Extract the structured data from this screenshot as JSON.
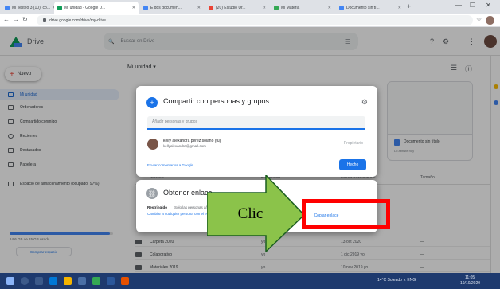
{
  "browser": {
    "tabs": [
      {
        "label": "Mi Testeo 3 (10), co...",
        "color": "#4285f4"
      },
      {
        "label": "Mi unidad - Google D...",
        "color": "#0f9d58"
      },
      {
        "label": "E dos documen...",
        "color": "#4285f4"
      },
      {
        "label": "(20) Estudio Ur...",
        "color": "#ea4335"
      },
      {
        "label": "Mi Materia",
        "color": "#34a853"
      },
      {
        "label": "Documento sin tí...",
        "color": "#4285f4"
      }
    ],
    "new_tab": "+",
    "window_controls": [
      "—",
      "❐",
      "✕"
    ],
    "url": "drive.google.com/drive/my-drive"
  },
  "drive": {
    "title": "Drive",
    "search_placeholder": "Buscar en Drive",
    "breadcrumb": "Mi unidad ▾"
  },
  "sidebar": {
    "new_label": "Nuevo",
    "items": [
      {
        "label": "Mi unidad"
      },
      {
        "label": "Ordenadores"
      },
      {
        "label": "Compartido conmigo"
      },
      {
        "label": "Recientes"
      },
      {
        "label": "Destacados"
      },
      {
        "label": "Papelera"
      },
      {
        "label": "Espacio de almacenamiento (ocupado: 97%)"
      }
    ],
    "storage_fraction": 0.97,
    "storage_text": "14,6 GB de 15 GB usado",
    "buy_label": "Comprar espacio"
  },
  "main": {
    "quick_cards": [
      {
        "label": "Documento sin título",
        "sub": "Lo abriste hoy"
      },
      {
        "label": "",
        "sub": ""
      }
    ],
    "list_header": [
      "Nombre",
      "Propietario",
      "Última modificación",
      "Tamaño"
    ],
    "files": [
      {
        "name": "Carpeta 2020",
        "owner": "yo",
        "modified": "13 oct 2020",
        "size": "—"
      },
      {
        "name": "Colaborativo",
        "owner": "yo",
        "modified": "1 dic 2019 yo",
        "size": "—"
      },
      {
        "name": "Materiales 2019",
        "owner": "yo",
        "modified": "10 nov 2019 yo",
        "size": "—"
      }
    ]
  },
  "share_dialog": {
    "title": "Compartir con personas y grupos",
    "input_placeholder": "Añadir personas y grupos",
    "person_name": "kelly alexandra pérez solano (tú)",
    "person_email": "kellyalexandra@gmail.com",
    "person_role": "Propietario",
    "feedback_link": "Enviar comentarios a Google",
    "done_label": "Hecho"
  },
  "link_dialog": {
    "title": "Obtener enlace",
    "restricted_label": "Restringido",
    "restricted_desc": "Solo las personas añadidas pueden abrir este enlace",
    "change_link": "Cambiar a cualquier persona con el enlace",
    "copy_link": "Copiar enlace"
  },
  "annotation": {
    "label": "Clic",
    "arrow_color": "#8bc34a",
    "box_color": "#ff0000"
  },
  "taskbar": {
    "status": "14°C Soleado ∧ ENG",
    "time": "11:05",
    "date": "19/10/2020"
  }
}
